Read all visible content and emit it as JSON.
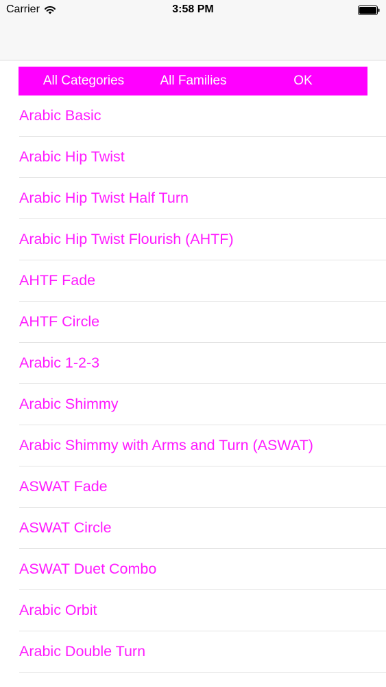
{
  "status_bar": {
    "carrier": "Carrier",
    "time": "3:58 PM",
    "wifi_icon": "wifi-icon",
    "battery_icon": "battery-icon"
  },
  "filter_bar": {
    "background": "#ff00ff",
    "all_categories": "All Categories",
    "all_families": "All Families",
    "ok": "OK"
  },
  "accent_color": "#ff1aff",
  "list": {
    "items": [
      "Arabic Basic",
      "Arabic Hip Twist",
      "Arabic Hip Twist Half Turn",
      "Arabic Hip Twist Flourish (AHTF)",
      "AHTF Fade",
      "AHTF Circle",
      "Arabic 1-2-3",
      "Arabic Shimmy",
      "Arabic Shimmy with Arms and Turn (ASWAT)",
      "ASWAT Fade",
      "ASWAT Circle",
      "ASWAT Duet Combo",
      "Arabic Orbit",
      "Arabic Double Turn"
    ]
  }
}
